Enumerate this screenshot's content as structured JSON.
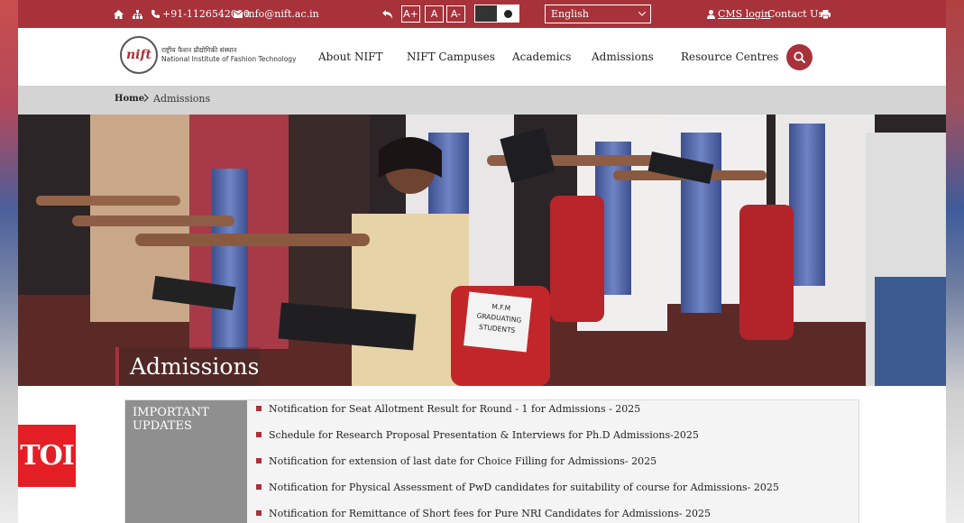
{
  "topbar": {
    "phone": "+91-1126542000",
    "email": "info@nift.ac.in",
    "font_increase": "A+",
    "font_normal": "A",
    "font_decrease": "A-",
    "language": "English",
    "cms_login": "CMS login",
    "contact": "Contact Us"
  },
  "header": {
    "logo_hindi": "राष्ट्रीय फैशन प्रौद्योगिकी संस्थान",
    "logo_english": "National Institute of Fashion Technology",
    "nav": [
      "About NIFT",
      "NIFT Campuses",
      "Academics",
      "Admissions",
      "Resource Centres"
    ]
  },
  "breadcrumb": {
    "home": "Home",
    "current": "Admissions"
  },
  "hero": {
    "title": "Admissions",
    "sign_text": [
      "M.F.M",
      "GRADUATING",
      "STUDENTS"
    ]
  },
  "updates": {
    "label": "IMPORTANT UPDATES",
    "items": [
      "Notification for Seat Allotment Result for Round - 1 for Admissions - 2025",
      "Schedule for Research Proposal Presentation & Interviews for Ph.D Admissions-2025",
      "Notification for extension of last date for Choice Filling for Admissions- 2025",
      "Notification for Physical Assessment of PwD candidates for suitability of course for Admissions- 2025",
      "Notification for Remittance of Short fees for Pure NRI Candidates for Admissions- 2025"
    ]
  },
  "watermark": "TOI",
  "colors": {
    "brand": "#a8323a",
    "breadcrumb_bg": "#d4d4d4",
    "updates_label_bg": "#8f8f8f"
  }
}
